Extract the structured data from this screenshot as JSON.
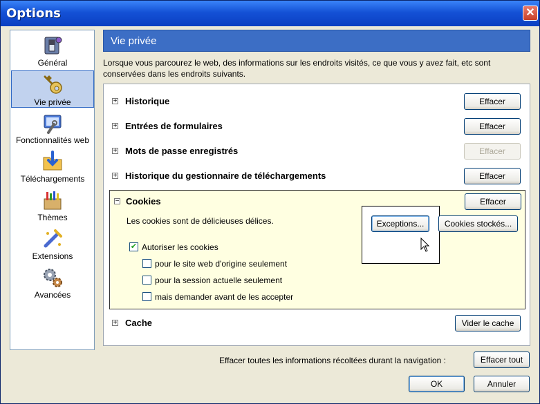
{
  "window": {
    "title": "Options",
    "close": "✕"
  },
  "sidebar": {
    "items": [
      {
        "label": "Général",
        "icon": "switch-icon"
      },
      {
        "label": "Vie privée",
        "icon": "key-icon",
        "selected": true
      },
      {
        "label": "Fonctionnalités web",
        "icon": "wrench-icon"
      },
      {
        "label": "Téléchargements",
        "icon": "download-folder-icon"
      },
      {
        "label": "Thèmes",
        "icon": "paint-icon"
      },
      {
        "label": "Extensions",
        "icon": "puzzle-icon"
      },
      {
        "label": "Avancées",
        "icon": "gears-icon"
      }
    ]
  },
  "panel": {
    "title": "Vie privée",
    "description": "Lorsque vous parcourez le web, des informations sur les endroits visités, ce que vous y avez fait, etc sont conservées dans les endroits suivants."
  },
  "sections": [
    {
      "title": "Historique",
      "expander": "+",
      "button": "Effacer"
    },
    {
      "title": "Entrées de formulaires",
      "expander": "+",
      "button": "Effacer"
    },
    {
      "title": "Mots de passe enregistrés",
      "expander": "+",
      "button": "Effacer",
      "disabled": true
    },
    {
      "title": "Historique du gestionnaire de téléchargements",
      "expander": "+",
      "button": "Effacer"
    },
    {
      "title": "Cookies",
      "expander": "−",
      "button": "Effacer"
    },
    {
      "title": "Cache",
      "expander": "+",
      "button": "Vider le cache"
    }
  ],
  "cookies": {
    "description": "Les cookies sont de délicieuses délices.",
    "exceptions_button": "Exceptions...",
    "stored_button": "Cookies stockés...",
    "check_mark": "✔",
    "options": [
      {
        "label": "Autoriser les cookies",
        "checked": true
      },
      {
        "label": "pour le site web d'origine seulement",
        "checked": false
      },
      {
        "label": "pour la session actuelle seulement",
        "checked": false
      },
      {
        "label": "mais demander avant de les accepter",
        "checked": false
      }
    ]
  },
  "footer": {
    "clear_all_text": "Effacer toutes les informations récoltées durant la navigation :",
    "clear_all_button": "Effacer tout",
    "ok": "OK",
    "cancel": "Annuler"
  },
  "colors": {
    "titlebar": "#1451d6",
    "header": "#3c6ec5",
    "cookie_bg": "#ffffe1",
    "selection": "#c1d2ee"
  }
}
